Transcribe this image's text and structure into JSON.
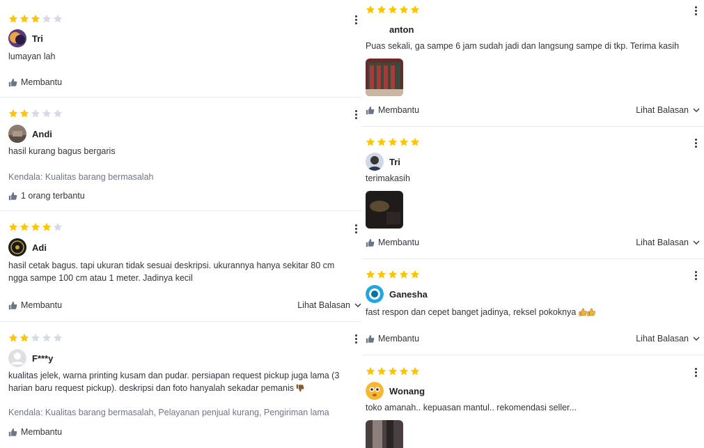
{
  "left_reviews": [
    {
      "rating": 3,
      "user": "Tri",
      "text": "lumayan lah",
      "kendala": "",
      "helpful": "Membantu",
      "reply": ""
    },
    {
      "rating": 2,
      "user": "Andi",
      "text": "hasil kurang bagus bergaris",
      "kendala": "Kendala: Kualitas barang bermasalah",
      "helpful": "1 orang terbantu",
      "reply": ""
    },
    {
      "rating": 4,
      "user": "Adi",
      "text": "hasil cetak bagus. tapi ukuran tidak sesuai deskripsi. ukurannya hanya sekitar 80 cm ngga sampe 100 cm atau 1 meter. Jadinya kecil",
      "kendala": "",
      "helpful": "Membantu",
      "reply": "Lihat Balasan"
    },
    {
      "rating": 2,
      "user": "F***y",
      "text": "kualitas jelek, warna printing kusam dan pudar. persiapan request pickup juga lama (3 harian baru request pickup). deskripsi dan foto hanyalah sekadar pemanis",
      "kendala": "Kendala: Kualitas barang bermasalah, Pelayanan penjual kurang, Pengiriman lama",
      "helpful": "Membantu",
      "reply": ""
    }
  ],
  "right_reviews": [
    {
      "rating": 5,
      "user": "anton",
      "text": "Puas sekali, ga sampe 6 jam sudah jadi dan langsung sampe di tkp. Terima kasih",
      "helpful": "Membantu",
      "reply": "Lihat Balasan"
    },
    {
      "rating": 5,
      "user": "Tri",
      "text": "terimakasih",
      "helpful": "Membantu",
      "reply": "Lihat Balasan"
    },
    {
      "rating": 5,
      "user": "Ganesha",
      "text": "fast respon dan cepet banget jadinya, reksel pokoknya",
      "helpful": "Membantu",
      "reply": "Lihat Balasan"
    },
    {
      "rating": 5,
      "user": "Wonang",
      "text": "toko amanah.. kepuasan mantul.. rekomendasi seller...",
      "helpful": "",
      "reply": ""
    }
  ],
  "colors": {
    "star_on": "#ffc400",
    "star_off": "#d6dbe3",
    "muted": "#6d7588",
    "text": "#31353b"
  },
  "icons": {
    "more": "kebab-icon",
    "helpful": "thumbs-up-icon",
    "reply": "chevron-down-icon",
    "dislike": "thumbs-down-icon",
    "like": "thumbs-up-emoji-icon"
  }
}
